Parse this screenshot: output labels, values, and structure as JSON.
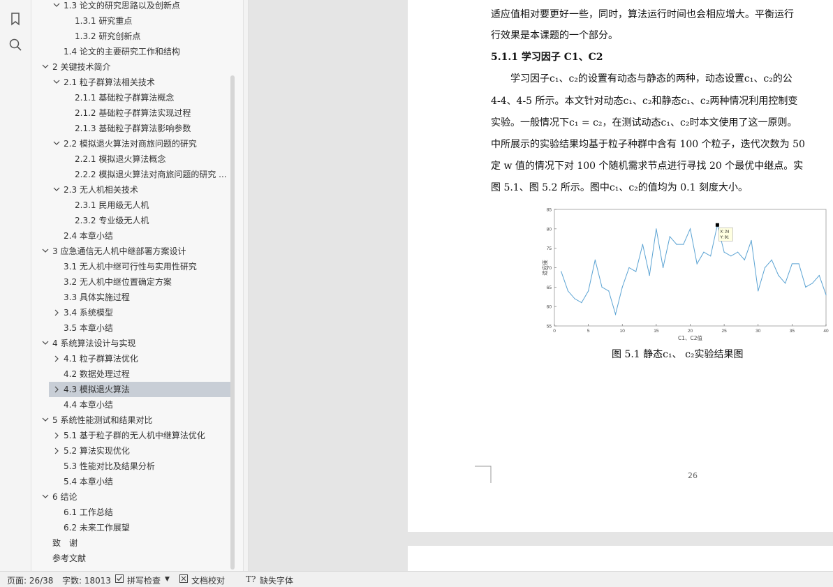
{
  "toc": {
    "items": [
      {
        "label": "1.3 论文的研究思路以及创新点",
        "chev": "v"
      },
      {
        "label": "1.3.1 研究重点",
        "chev": ""
      },
      {
        "label": "1.3.2 研究创新点",
        "chev": ""
      },
      {
        "label": "1.4 论文的主要研究工作和结构",
        "chev": ""
      },
      {
        "label": "2 关键技术简介",
        "chev": "v"
      },
      {
        "label": "2.1 粒子群算法相关技术",
        "chev": "v"
      },
      {
        "label": "2.1.1 基础粒子群算法概念",
        "chev": ""
      },
      {
        "label": "2.1.2 基础粒子群算法实现过程",
        "chev": ""
      },
      {
        "label": "2.1.3 基础粒子群算法影响参数",
        "chev": ""
      },
      {
        "label": "2.2 模拟退火算法对商旅问题的研究",
        "chev": "v"
      },
      {
        "label": "2.2.1 模拟退火算法概念",
        "chev": ""
      },
      {
        "label": "2.2.2 模拟退火算法对商旅问题的研究 ...",
        "chev": ""
      },
      {
        "label": "2.3 无人机相关技术",
        "chev": "v"
      },
      {
        "label": "2.3.1 民用级无人机",
        "chev": ""
      },
      {
        "label": "2.3.2 专业级无人机",
        "chev": ""
      },
      {
        "label": "2.4 本章小结",
        "chev": ""
      },
      {
        "label": "3 应急通信无人机中继部署方案设计",
        "chev": "v"
      },
      {
        "label": "3.1 无人机中继可行性与实用性研究",
        "chev": ""
      },
      {
        "label": "3.2 无人机中继位置确定方案",
        "chev": ""
      },
      {
        "label": "3.3 具体实施过程",
        "chev": ""
      },
      {
        "label": "3.4 系统模型",
        "chev": ">"
      },
      {
        "label": "3.5 本章小结",
        "chev": ""
      },
      {
        "label": "4 系统算法设计与实现",
        "chev": "v"
      },
      {
        "label": "4.1 粒子群算法优化",
        "chev": ">"
      },
      {
        "label": "4.2 数据处理过程",
        "chev": ""
      },
      {
        "label": "4.3 模拟退火算法",
        "chev": ">"
      },
      {
        "label": "4.4 本章小结",
        "chev": ""
      },
      {
        "label": "5 系统性能测试和结果对比",
        "chev": "v"
      },
      {
        "label": "5.1 基于粒子群的无人机中继算法优化",
        "chev": ">"
      },
      {
        "label": "5.2 算法实现优化",
        "chev": ">"
      },
      {
        "label": "5.3 性能对比及结果分析",
        "chev": ""
      },
      {
        "label": "5.4 本章小结",
        "chev": ""
      },
      {
        "label": "6 结论",
        "chev": "v"
      },
      {
        "label": "6.1 工作总结",
        "chev": ""
      },
      {
        "label": "6.2 未来工作展望",
        "chev": ""
      },
      {
        "label": "致　谢",
        "chev": ""
      },
      {
        "label": "参考文献",
        "chev": ""
      }
    ],
    "selected_label": "4.3 模拟退火算法"
  },
  "document": {
    "lines": [
      "适应值相对要更好一些，同时，算法运行时间也会相应增大。平衡运行",
      "行效果是本课题的一个部分。"
    ],
    "heading": "5.1.1 学习因子 C1、C2",
    "body": [
      "　　学习因子c₁、c₂的设置有动态与静态的两种，动态设置c₁、c₂的公",
      "4-4、4-5 所示。本文针对动态c₁、c₂和静态c₁、c₂两种情况利用控制变",
      "实验。一般情况下c₁ = c₂，在测试动态c₁、c₂时本文使用了这一原则。",
      "中所展示的实验结果均基于粒子种群中含有 100 个粒子，迭代次数为 50",
      "定 w 值的情况下对 100 个随机需求节点进行寻找 20 个最优中继点。实",
      "图 5.1、图 5.2 所示。图中c₁、c₂的值均为 0.1 刻度大小。"
    ],
    "caption": "图  5.1 静态c₁、 c₂实验结果图",
    "page_number": "26"
  },
  "chart_data": {
    "type": "line",
    "xlabel": "C1、C2值",
    "ylabel": "适应度",
    "xlim": [
      0,
      40
    ],
    "ylim": [
      55,
      85
    ],
    "xticks": [
      0,
      5,
      10,
      15,
      20,
      25,
      30,
      35,
      40
    ],
    "yticks": [
      55,
      60,
      65,
      70,
      75,
      80,
      85
    ],
    "x": [
      1,
      2,
      3,
      4,
      5,
      6,
      7,
      8,
      9,
      10,
      11,
      12,
      13,
      14,
      15,
      16,
      17,
      18,
      19,
      20,
      21,
      22,
      23,
      24,
      25,
      26,
      27,
      28,
      29,
      30,
      31,
      32,
      33,
      34,
      35,
      36,
      37,
      38,
      39,
      40
    ],
    "y": [
      69,
      64,
      62,
      61,
      64,
      72,
      65,
      64,
      58,
      65,
      70,
      69,
      76,
      68,
      80,
      70,
      78,
      76,
      76,
      80,
      71,
      74,
      73,
      81,
      74,
      73,
      74,
      72,
      77,
      64,
      70,
      72,
      68,
      66,
      71,
      71,
      65,
      66,
      68,
      63
    ],
    "datatip": {
      "x_label": "X: 24",
      "y_label": "Y: 81",
      "x": 24,
      "y": 81
    },
    "line_color": "#5ba3d3"
  },
  "statusbar": {
    "page": "页面: 26/38",
    "words": "字数: 18013",
    "spell": "拼写检查",
    "compare": "文档校对",
    "missing_font": "缺失字体"
  }
}
